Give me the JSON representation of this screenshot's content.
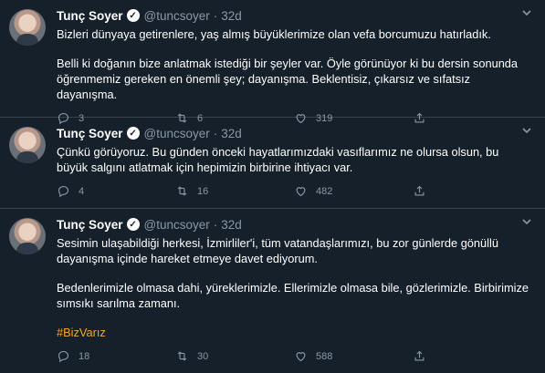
{
  "tweets": [
    {
      "name": "Tunç Soyer",
      "handle": "@tuncsoyer",
      "time": "32d",
      "paragraphs": [
        "Bizleri dünyaya getirenlere, yaş almış büyüklerimize olan vefa borcumuzu hatırladık.",
        "Belli ki doğanın bize anlatmak istediği bir şeyler var. Öyle görünüyor ki bu dersin sonunda öğrenmemiz gereken en önemli şey; dayanışma. Beklentisiz, çıkarsız ve sıfatsız dayanışma."
      ],
      "replies": "3",
      "retweets": "6",
      "likes": "319"
    },
    {
      "name": "Tunç Soyer",
      "handle": "@tuncsoyer",
      "time": "32d",
      "paragraphs": [
        "Çünkü görüyoruz. Bu günden önceki hayatlarımızdaki vasıflarımız ne olursa olsun, bu büyük salgını atlatmak için hepimizin birbirine ihtiyacı var."
      ],
      "replies": "4",
      "retweets": "16",
      "likes": "482"
    },
    {
      "name": "Tunç Soyer",
      "handle": "@tuncsoyer",
      "time": "32d",
      "paragraphs": [
        "Sesimin ulaşabildiği herkesi, İzmirliler'i, tüm vatandaşlarımızı, bu zor günlerde gönüllü dayanışma içinde hareket etmeye davet ediyorum.",
        "Bedenlerimizle olmasa dahi, yüreklerimizle. Ellerimizle olmasa bile, gözlerimizle. Birbirimize sımsıkı sarılma zamanı."
      ],
      "hashtag": "#BizVarız",
      "replies": "18",
      "retweets": "30",
      "likes": "588"
    }
  ],
  "icons": {
    "verified": "verified-badge-icon",
    "more": "chevron-down-icon",
    "reply": "reply-icon",
    "retweet": "retweet-icon",
    "like": "heart-icon",
    "share": "share-icon"
  },
  "colors": {
    "background": "#15202b",
    "text": "#ffffff",
    "muted": "#8899a6",
    "divider": "#38444d",
    "hashtag": "#f5a623"
  }
}
